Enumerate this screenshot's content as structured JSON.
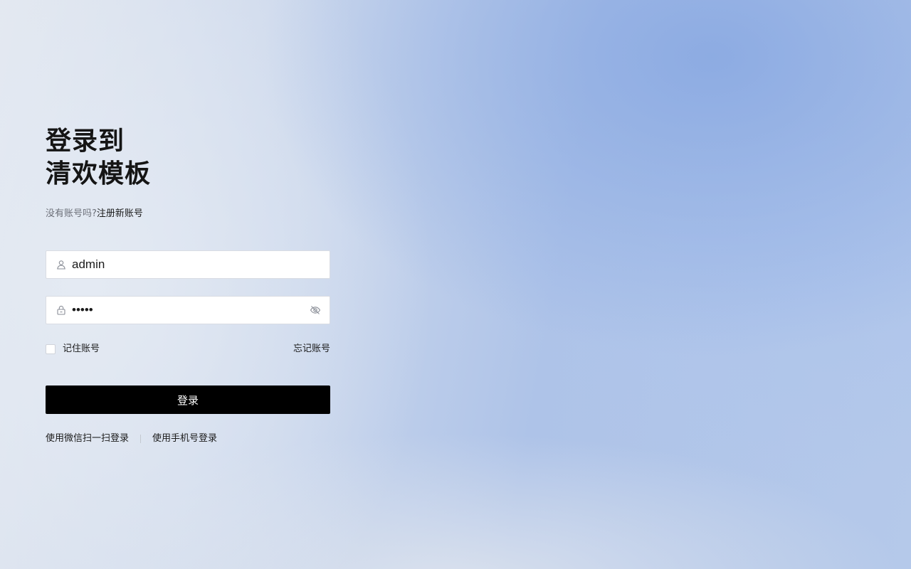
{
  "title": {
    "line1": "登录到",
    "line2": "清欢模板"
  },
  "register": {
    "prompt": "没有账号吗?",
    "link_label": "注册新账号"
  },
  "username": {
    "value": "admin",
    "icon": "user-icon"
  },
  "password": {
    "value": "admin",
    "icon": "lock-icon",
    "toggle_icon": "eye-off-icon"
  },
  "options": {
    "remember_label": "记住账号",
    "remember_checked": false,
    "forgot_label": "忘记账号"
  },
  "login_button": {
    "label": "登录"
  },
  "alt_login": {
    "wechat_label": "使用微信扫一扫登录",
    "phone_label": "使用手机号登录"
  },
  "colors": {
    "button_bg": "#000000",
    "button_text": "#ffffff",
    "muted_text": "#6b6f78"
  }
}
